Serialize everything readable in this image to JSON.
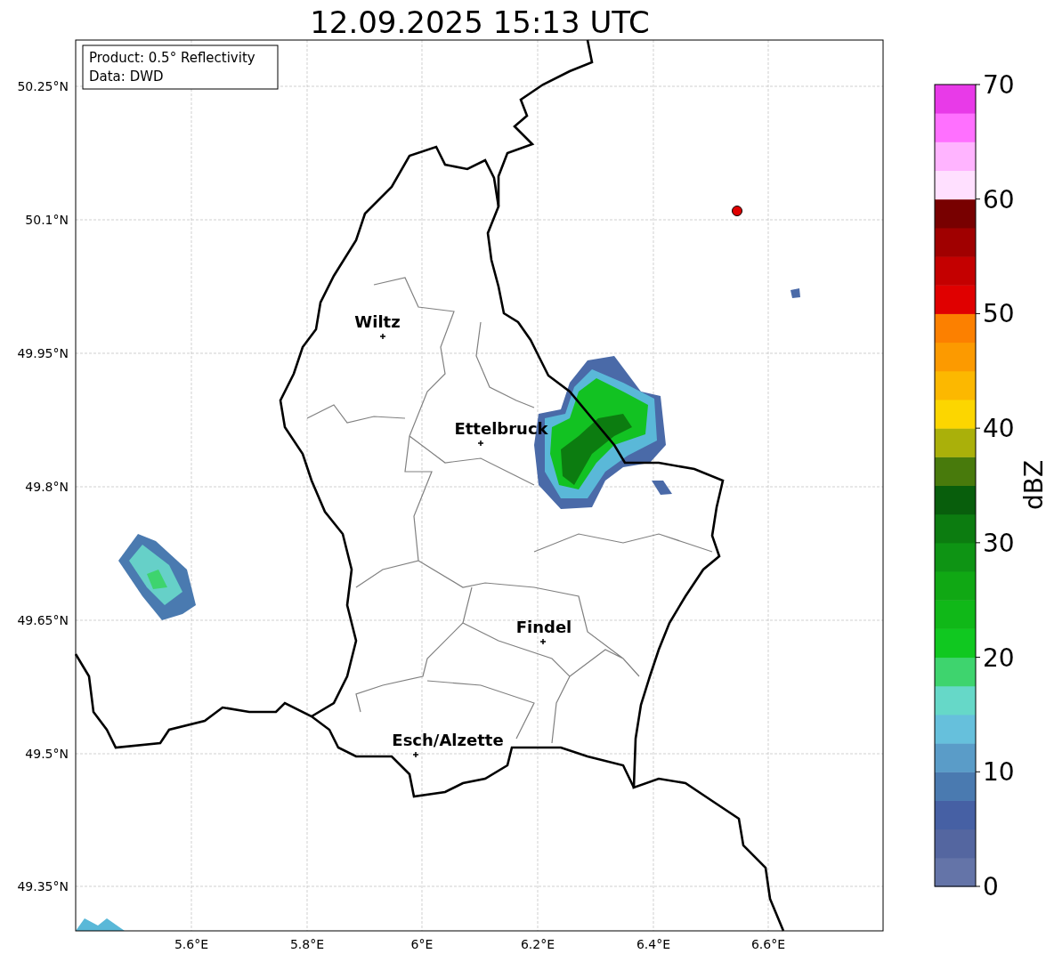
{
  "title": "12.09.2025 15:13 UTC",
  "info_box": [
    "Product: 0.5° Reflectivity",
    "Data: DWD"
  ],
  "map": {
    "yticks": [
      "50.25°N",
      "50.1°N",
      "49.95°N",
      "49.8°N",
      "49.65°N",
      "49.5°N",
      "49.35°N"
    ],
    "xticks": [
      "5.6°E",
      "5.8°E",
      "6°E",
      "6.2°E",
      "6.4°E",
      "6.6°E"
    ],
    "cities": [
      {
        "name": "Wiltz"
      },
      {
        "name": "Ettelbruck"
      },
      {
        "name": "Findel"
      },
      {
        "name": "Esch/Alzette"
      }
    ]
  },
  "colorbar": {
    "label": "dBZ",
    "ticks": [
      "70",
      "60",
      "50",
      "40",
      "30",
      "20",
      "10",
      "0"
    ],
    "bands": [
      {
        "color": "#6474a8"
      },
      {
        "color": "#5466a0"
      },
      {
        "color": "#4660a4"
      },
      {
        "color": "#4a7ab0"
      },
      {
        "color": "#5a9cc8"
      },
      {
        "color": "#66c0dc"
      },
      {
        "color": "#66d8c8"
      },
      {
        "color": "#3ed46e"
      },
      {
        "color": "#10c820"
      },
      {
        "color": "#10b818"
      },
      {
        "color": "#10a814"
      },
      {
        "color": "#0e9414"
      },
      {
        "color": "#0c7c10"
      },
      {
        "color": "#085e0c"
      },
      {
        "color": "#487a0c"
      },
      {
        "color": "#aab00a"
      },
      {
        "color": "#fcd600"
      },
      {
        "color": "#fcb800"
      },
      {
        "color": "#fc9a00"
      },
      {
        "color": "#fc8000"
      },
      {
        "color": "#e00000"
      },
      {
        "color": "#c40000"
      },
      {
        "color": "#a00000"
      },
      {
        "color": "#780000"
      },
      {
        "color": "#ffe0ff"
      },
      {
        "color": "#ffb4ff"
      },
      {
        "color": "#ff70ff"
      },
      {
        "color": "#e83ae8"
      }
    ]
  }
}
